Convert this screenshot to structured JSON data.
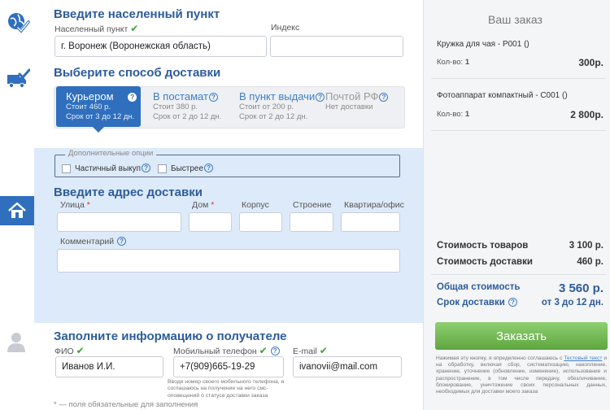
{
  "sections": {
    "location": {
      "title": "Введите населенный пункт",
      "city_label": "Населенный пункт",
      "city_value": "г. Воронеж (Воронежская область)",
      "index_label": "Индекс",
      "index_value": ""
    },
    "delivery": {
      "title": "Выберите способ доставки",
      "options": [
        {
          "name": "Курьером",
          "cost": "Стоит 460 р.",
          "term": "Срок от 3 до 12 дн."
        },
        {
          "name": "В постамат",
          "cost": "Стоит 380 р.",
          "term": "Срок от 2 до 12 дн."
        },
        {
          "name": "В пункт выдачи",
          "cost": "Стоит от 200 р.",
          "term": "Срок от 2 до 12 дн."
        },
        {
          "name": "Почтой РФ",
          "cost": "Нет доставки",
          "term": ""
        }
      ],
      "selected_index": 0
    },
    "extra_options": {
      "legend": "Дополнительные опции",
      "partial_label": "Частичный выкуп",
      "faster_label": "Быстрее",
      "partial_checked": false,
      "faster_checked": false
    },
    "address": {
      "title": "Введите адрес доставки",
      "street_label": "Улица",
      "house_label": "Дом",
      "building_label": "Корпус",
      "structure_label": "Строение",
      "flat_label": "Квартира/офис",
      "comment_label": "Комментарий",
      "required_mark": "*"
    },
    "recipient": {
      "title": "Заполните информацию о получателе",
      "name_label": "ФИО",
      "name_value": "Иванов И.И.",
      "phone_label": "Мобильный телефон",
      "phone_value": "+7(909)665-19-29",
      "email_label": "E-mail",
      "email_value": "ivanovii@mail.com",
      "phone_note": "Вводя номер своего мобильного телефона, я соглашаюсь на получение на него смс-оповещений о статусе доставки заказа",
      "required_note": "* — поля обязательные для заполнения"
    }
  },
  "order": {
    "title": "Ваш заказ",
    "qty_label": "Кол-во:",
    "items": [
      {
        "name": "Кружка для чая - P001 ()",
        "qty": "1",
        "price": "300р."
      },
      {
        "name": "Фотоаппарат компактный - C001 ()",
        "qty": "1",
        "price": "2 800р."
      }
    ],
    "goods_label": "Стоимость товаров",
    "goods_value": "3 100 р.",
    "delivery_label": "Стоимость доставки",
    "delivery_value": "460 р.",
    "total_label": "Общая стоимость",
    "total_value": "3 560 р.",
    "term_label": "Срок доставки",
    "term_value": "от 3 до 12 дн.",
    "button_label": "Заказать",
    "consent_before": "Нажимая эту кнопку, я определенно соглашаюсь с ",
    "consent_link": "Тестовый текст",
    "consent_after": " и на обработку, включая сбор, систематизацию, накопление, хранение, уточнение (обновление, изменение), использование и распространение, в том числе передачу, обезличивание, блокирование, уничтожение своих персональных данных, необходимых для доставки моего заказа"
  },
  "colors": {
    "accent": "#2f6fbd",
    "title": "#2d5c9a",
    "band": "#ddeaf9",
    "button": "#6cb34b",
    "check": "#3aa13a"
  },
  "icons": [
    "globe-check-icon",
    "truck-check-icon",
    "house-icon",
    "person-icon",
    "check-icon",
    "question-icon"
  ]
}
